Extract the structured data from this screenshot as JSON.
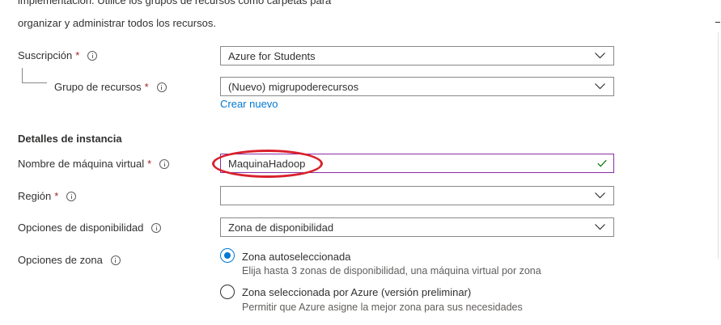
{
  "intro": {
    "cut_text": "implementación. Utilice los grupos de recursos como carpetas para",
    "text": "organizar y administrar todos los recursos."
  },
  "subscription": {
    "label": "Suscripción",
    "required": "*",
    "value": "Azure for Students"
  },
  "resource_group": {
    "label": "Grupo de recursos",
    "required": "*",
    "value": "(Nuevo) migrupoderecursos",
    "create_link": "Crear nuevo"
  },
  "instance_details": {
    "heading": "Detalles de instancia",
    "vm_name": {
      "label": "Nombre de máquina virtual",
      "required": "*",
      "value": "MaquinaHadoop"
    },
    "region": {
      "label": "Región",
      "required": "*",
      "value": ""
    },
    "availability": {
      "label": "Opciones de disponibilidad",
      "value": "Zona de disponibilidad"
    },
    "zone_options": {
      "label": "Opciones de zona",
      "options": [
        {
          "title": "Zona autoseleccionada",
          "description": "Elija hasta 3 zonas de disponibilidad, una máquina virtual por zona",
          "selected": true
        },
        {
          "title": "Zona seleccionada por Azure (versión preliminar)",
          "description": "Permitir que Azure asigne la mejor zona para sus necesidades",
          "selected": false
        }
      ]
    }
  },
  "colors": {
    "accent": "#0078d4",
    "required": "#a4262c",
    "annotation": "#d9202b",
    "valid": "#107c10",
    "focus_border": "#8a2da5"
  }
}
